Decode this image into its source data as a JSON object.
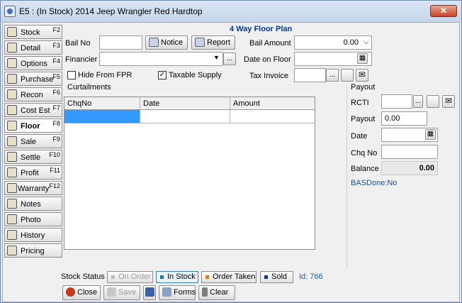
{
  "window": {
    "title": "E5 : (In Stock) 2014 Jeep Wrangler  Red Hardtop",
    "close_label": "✕"
  },
  "nav": [
    {
      "label": "Stock",
      "key": "F2",
      "icon": "car-door-icon",
      "active": false
    },
    {
      "label": "Detail",
      "key": "F3",
      "icon": "detail-icon",
      "active": false
    },
    {
      "label": "Options",
      "key": "F4",
      "icon": "options-icon",
      "active": false
    },
    {
      "label": "Purchase",
      "key": "F5",
      "icon": "purchase-icon",
      "active": false
    },
    {
      "label": "Recon",
      "key": "F6",
      "icon": "recon-icon",
      "active": false
    },
    {
      "label": "Cost Est",
      "key": "F7",
      "icon": "cost-est-icon",
      "active": false
    },
    {
      "label": "Floor",
      "key": "F8",
      "icon": "floor-icon",
      "active": true
    },
    {
      "label": "Sale",
      "key": "F9",
      "icon": "sale-icon",
      "active": false
    },
    {
      "label": "Settle",
      "key": "F10",
      "icon": "settle-icon",
      "active": false
    },
    {
      "label": "Profit",
      "key": "F11",
      "icon": "profit-icon",
      "active": false
    },
    {
      "label": "Warranty",
      "key": "F12",
      "icon": "warranty-icon",
      "active": false
    },
    {
      "label": "Notes",
      "key": "",
      "icon": "notes-icon",
      "active": false
    },
    {
      "label": "Photo",
      "key": "",
      "icon": "photo-icon",
      "active": false
    },
    {
      "label": "History",
      "key": "",
      "icon": "history-icon",
      "active": false
    },
    {
      "label": "Pricing",
      "key": "",
      "icon": "pricing-icon",
      "active": false
    }
  ],
  "form": {
    "heading": "4 Way Floor Plan",
    "bail_no_label": "Bail No",
    "bail_no_value": "",
    "notice_label": "Notice",
    "report_label": "Report",
    "bail_amount_label": "Bail Amount",
    "bail_amount_value": "0.00",
    "financier_label": "Financier",
    "financier_value": "",
    "ellipsis_label": "...",
    "date_on_floor_label": "Date on Floor",
    "date_on_floor_value": "",
    "hide_fpr_label": "Hide From FPR",
    "hide_fpr_checked": false,
    "taxable_label": "Taxable Supply",
    "taxable_checked": true,
    "tax_invoice_label": "Tax Invoice",
    "tax_invoice_value": "",
    "curtailments_label": "Curtailments"
  },
  "grid": {
    "columns": [
      "ChqNo",
      "Date",
      "Amount"
    ],
    "rows": [
      [
        "",
        "",
        ""
      ]
    ]
  },
  "payout": {
    "heading": "Payout",
    "rcti_label": "RCTI",
    "rcti_value": "",
    "payout_label": "Payout",
    "payout_value": "0.00",
    "date_label": "Date",
    "date_value": "",
    "chq_no_label": "Chq No",
    "chq_no_value": "",
    "balance_label": "Balance",
    "balance_value": "0.00",
    "bas_done": "BASDone:No"
  },
  "status": {
    "label": "Stock Status",
    "on_order": "On Order",
    "in_stock": "In Stock",
    "order_taken": "Order Taken",
    "sold": "Sold",
    "id": "Id: 766",
    "colors": {
      "in_stock": "#2e6fb0",
      "order_taken": "#e07b20",
      "sold": "#1a2fa0",
      "id_text": "#1a5a9a"
    }
  },
  "footer": {
    "close": "Close",
    "save": "Save",
    "forms": "Forms",
    "clear": "Clear"
  }
}
